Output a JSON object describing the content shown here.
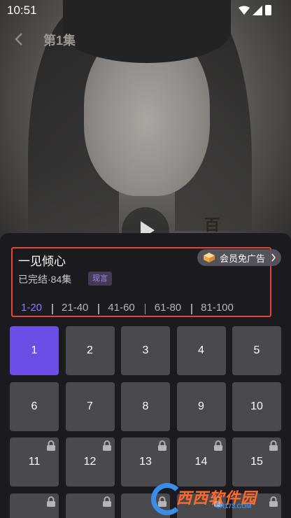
{
  "status_bar": {
    "time": "10:51"
  },
  "header": {
    "title": "第1集"
  },
  "drama": {
    "title": "一见倾心",
    "status": "已完结·84集",
    "genre_tag": "现言",
    "vip_button_label": "会员免广告"
  },
  "ranges": [
    {
      "label": "1-20",
      "active": true
    },
    {
      "label": "21-40",
      "active": false
    },
    {
      "label": "41-60",
      "active": false
    },
    {
      "label": "61-80",
      "active": false
    },
    {
      "label": "81-100",
      "active": false
    }
  ],
  "episodes": [
    {
      "label": "1",
      "active": true,
      "locked": false
    },
    {
      "label": "2",
      "active": false,
      "locked": false
    },
    {
      "label": "3",
      "active": false,
      "locked": false
    },
    {
      "label": "4",
      "active": false,
      "locked": false
    },
    {
      "label": "5",
      "active": false,
      "locked": false
    },
    {
      "label": "6",
      "active": false,
      "locked": false
    },
    {
      "label": "7",
      "active": false,
      "locked": false
    },
    {
      "label": "8",
      "active": false,
      "locked": false
    },
    {
      "label": "9",
      "active": false,
      "locked": false
    },
    {
      "label": "10",
      "active": false,
      "locked": false
    },
    {
      "label": "11",
      "active": false,
      "locked": true
    },
    {
      "label": "12",
      "active": false,
      "locked": true
    },
    {
      "label": "13",
      "active": false,
      "locked": true
    },
    {
      "label": "14",
      "active": false,
      "locked": true
    },
    {
      "label": "15",
      "active": false,
      "locked": true
    },
    {
      "label": "",
      "active": false,
      "locked": true
    },
    {
      "label": "",
      "active": false,
      "locked": true
    },
    {
      "label": "",
      "active": false,
      "locked": true
    },
    {
      "label": "",
      "active": false,
      "locked": true
    },
    {
      "label": "",
      "active": false,
      "locked": true
    }
  ],
  "watermark": {
    "logo_text": "西西软件园",
    "logo_sub": "CR173.COM"
  },
  "colors": {
    "accent": "#6a4ee6",
    "highlight_box": "#e5443a",
    "tag_text": "#a786f3"
  },
  "icons": [
    "back-arrow-icon",
    "wifi-icon",
    "signal-icon",
    "battery-icon",
    "play-icon",
    "gift-icon",
    "chevron-right-icon",
    "lock-icon"
  ]
}
